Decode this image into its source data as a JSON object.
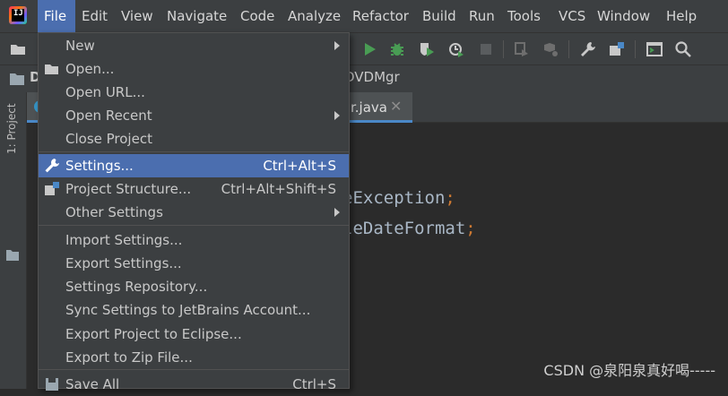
{
  "menubar": {
    "items": [
      {
        "label": "File"
      },
      {
        "label": "Edit"
      },
      {
        "label": "View"
      },
      {
        "label": "Navigate"
      },
      {
        "label": "Code"
      },
      {
        "label": "Analyze"
      },
      {
        "label": "Refactor"
      },
      {
        "label": "Build"
      },
      {
        "label": "Run"
      },
      {
        "label": "Tools"
      },
      {
        "label": "VCS"
      },
      {
        "label": "Window"
      },
      {
        "label": "Help"
      }
    ]
  },
  "navbar": {
    "project_initial": "D",
    "crumb": "DVDMgr"
  },
  "leftstrip": {
    "project_tab": "1: Project"
  },
  "editor": {
    "tab_label": "r.java",
    "lines": [
      "eException",
      "leDateFormat"
    ],
    "semicolon": ";"
  },
  "file_menu": {
    "items": [
      {
        "label": "New",
        "shortcut": "",
        "submenu": true
      },
      {
        "label": "Open...",
        "shortcut": "",
        "submenu": false
      },
      {
        "label": "Open URL...",
        "shortcut": "",
        "submenu": false
      },
      {
        "label": "Open Recent",
        "shortcut": "",
        "submenu": true
      },
      {
        "label": "Close Project",
        "shortcut": "",
        "submenu": false
      },
      {
        "label": "Settings...",
        "shortcut": "Ctrl+Alt+S",
        "submenu": false,
        "selected": true
      },
      {
        "label": "Project Structure...",
        "shortcut": "Ctrl+Alt+Shift+S",
        "submenu": false
      },
      {
        "label": "Other Settings",
        "shortcut": "",
        "submenu": true
      },
      {
        "label": "Import Settings...",
        "shortcut": "",
        "submenu": false
      },
      {
        "label": "Export Settings...",
        "shortcut": "",
        "submenu": false
      },
      {
        "label": "Settings Repository...",
        "shortcut": "",
        "submenu": false
      },
      {
        "label": "Sync Settings to JetBrains Account...",
        "shortcut": "",
        "submenu": false
      },
      {
        "label": "Export Project to Eclipse...",
        "shortcut": "",
        "submenu": false
      },
      {
        "label": "Export to Zip File...",
        "shortcut": "",
        "submenu": false
      },
      {
        "label": "Save All",
        "shortcut": "Ctrl+S",
        "submenu": false
      }
    ]
  },
  "watermark": "CSDN @泉阳泉真好喝-----",
  "colors": {
    "selection": "#4b6eaf",
    "run_green": "#499c54",
    "background": "#2b2b2b",
    "panel": "#3c3f41"
  }
}
